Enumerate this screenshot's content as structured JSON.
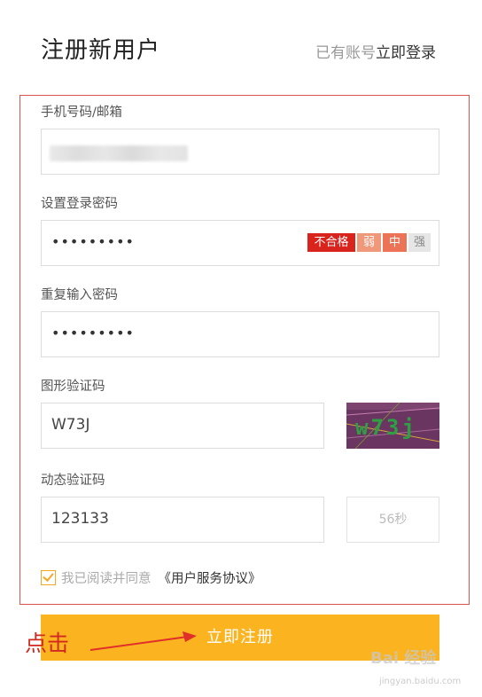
{
  "header": {
    "title": "注册新用户",
    "login_prompt": "已有账号",
    "login_link": "立即登录"
  },
  "form": {
    "phone": {
      "label": "手机号码/邮箱"
    },
    "password": {
      "label": "设置登录密码",
      "value": "•••••••••"
    },
    "strength": {
      "fail": "不合格",
      "weak": "弱",
      "medium": "中",
      "strong": "强"
    },
    "confirm_password": {
      "label": "重复输入密码",
      "value": "•••••••••"
    },
    "captcha": {
      "label": "图形验证码",
      "value": "W73J",
      "image_text": "w73j"
    },
    "sms_code": {
      "label": "动态验证码",
      "value": "123133",
      "countdown": "56秒"
    },
    "agreement": {
      "text": "我已阅读并同意",
      "link": "《用户服务协议》",
      "checked": true
    },
    "submit": "立即注册"
  },
  "annotation": {
    "text": "点击",
    "color": "#d02a20"
  },
  "watermark": {
    "main": "Bai 经验",
    "sub": "jingyan.baidu.com"
  },
  "colors": {
    "accent": "#fcb320",
    "strength_fail": "#d9231d",
    "highlight_border": "#d9534f"
  }
}
